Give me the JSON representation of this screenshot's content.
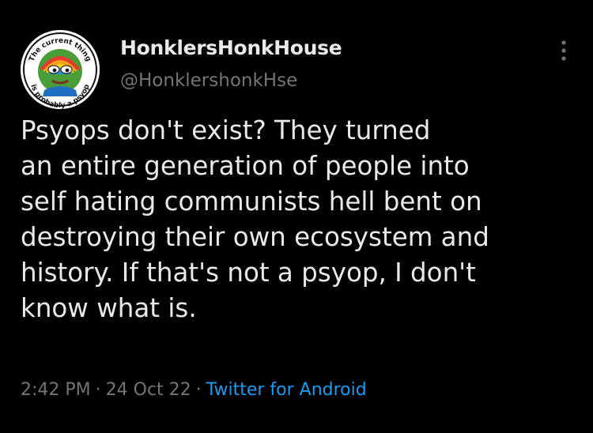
{
  "author": {
    "display_name": "HonklersHonkHouse",
    "handle": "@HonklershonkHse",
    "avatar_text_top": "The current thing",
    "avatar_text_bottom": "is probably a psyop"
  },
  "tweet": {
    "lines": [
      "Psyops don't exist? They turned",
      "an entire generation of people into",
      "self hating communists hell bent on",
      "destroying their own ecosystem and",
      "history. If that's not a psyop, I don't",
      "know what is."
    ]
  },
  "meta": {
    "time": "2:42 PM",
    "date": "24 Oct 22",
    "source": "Twitter for Android",
    "separator": "·"
  },
  "icons": {
    "more": "more-vertical-icon"
  },
  "colors": {
    "background": "#000000",
    "text": "#e7e9ea",
    "muted": "#71767b",
    "link": "#1d9bf0"
  }
}
